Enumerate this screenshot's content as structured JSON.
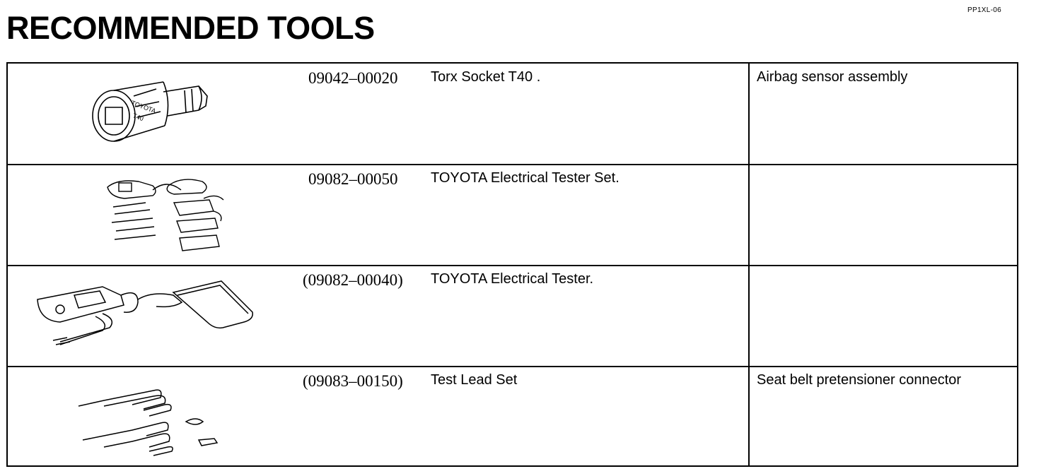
{
  "header": {
    "doc_code": "PP1XL-06",
    "title": "RECOMMENDED TOOLS"
  },
  "tools": [
    {
      "part_number": "09042–00020",
      "name": "Torx Socket T40 .",
      "usage": "Airbag sensor assembly",
      "illustration": "torx-socket-icon"
    },
    {
      "part_number": "09082–00050",
      "name": "TOYOTA Electrical Tester Set.",
      "usage": "",
      "illustration": "tester-set-icon"
    },
    {
      "part_number": "(09082–00040)",
      "name": "TOYOTA Electrical Tester.",
      "usage": "",
      "illustration": "electrical-tester-icon"
    },
    {
      "part_number": "(09083–00150)",
      "name": "Test Lead Set",
      "usage": "Seat belt pretensioner connector",
      "illustration": "test-lead-set-icon"
    }
  ]
}
